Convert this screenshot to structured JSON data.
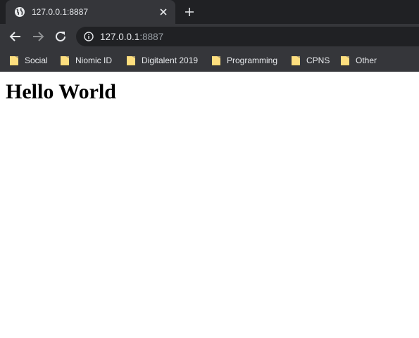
{
  "browser": {
    "tab": {
      "title": "127.0.0.1:8887",
      "favicon": "globe-icon"
    },
    "new_tab_icon": "plus-icon",
    "toolbar": {
      "back_icon": "arrow-left-icon",
      "forward_icon": "arrow-right-icon",
      "reload_icon": "reload-icon",
      "site_info_icon": "info-icon",
      "url_host": "127.0.0.1",
      "url_port": ":8887"
    },
    "bookmarks": [
      {
        "label": "Social",
        "icon": "folder-icon"
      },
      {
        "label": "Niomic ID",
        "icon": "folder-icon"
      },
      {
        "label": "Digitalent 2019",
        "icon": "folder-icon"
      },
      {
        "label": "Programming",
        "icon": "folder-icon"
      },
      {
        "label": "CPNS",
        "icon": "folder-icon"
      },
      {
        "label": "Other",
        "icon": "folder-icon"
      }
    ]
  },
  "page": {
    "heading": "Hello World"
  },
  "colors": {
    "tab_strip": "#202124",
    "toolbar": "#35363a",
    "omnibox": "#202124",
    "folder": "#fdd663",
    "page_bg": "#ffffff"
  }
}
